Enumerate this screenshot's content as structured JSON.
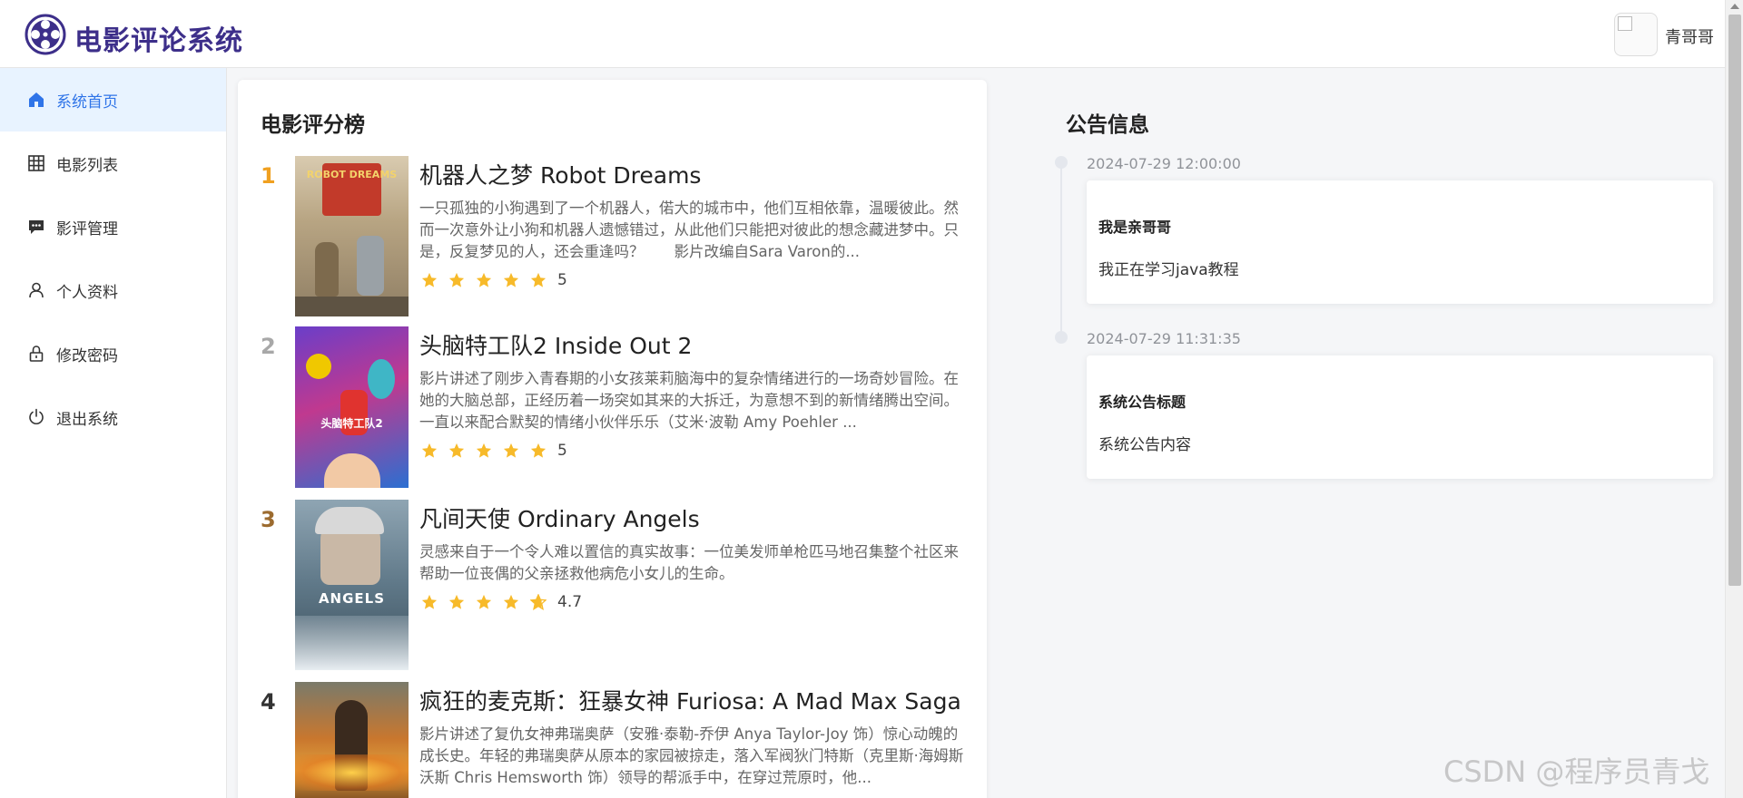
{
  "header": {
    "app_title": "电影评论系统",
    "user_name": "青哥哥",
    "brand_color": "#3d2f8a"
  },
  "sidebar": {
    "items": [
      {
        "label": "系统首页",
        "icon": "home-icon",
        "active": true
      },
      {
        "label": "电影列表",
        "icon": "grid-icon",
        "active": false
      },
      {
        "label": "影评管理",
        "icon": "comment-icon",
        "active": false
      },
      {
        "label": "个人资料",
        "icon": "user-icon",
        "active": false
      },
      {
        "label": "修改密码",
        "icon": "lock-icon",
        "active": false
      },
      {
        "label": "退出系统",
        "icon": "power-icon",
        "active": false
      }
    ]
  },
  "ranking": {
    "title": "电影评分榜",
    "movies": [
      {
        "rank": "1",
        "rank_color": "#f0a020",
        "title": "机器人之梦 Robot Dreams",
        "description": "一只孤独的小狗遇到了一个机器人，偌大的城市中，他们互相依靠，温暖彼此。然而一次意外让小狗和机器人遗憾错过，从此他们只能把对彼此的想念藏进梦中。只是，反复梦见的人，还会重逢吗？　　影片改编自Sara Varon的...",
        "score": "5",
        "stars": 5,
        "poster_text": "ROBOT DREAMS"
      },
      {
        "rank": "2",
        "rank_color": "#a8a8a8",
        "title": "头脑特工队2 Inside Out 2",
        "description": "影片讲述了刚步入青春期的小女孩莱莉脑海中的复杂情绪进行的一场奇妙冒险。在她的大脑总部，正经历着一场突如其来的大拆迁，为意想不到的新情绪腾出空间。一直以来配合默契的情绪小伙伴乐乐（艾米·波勒 Amy Poehler ...",
        "score": "5",
        "stars": 5,
        "poster_text": "头脑特工队2"
      },
      {
        "rank": "3",
        "rank_color": "#9c6b2f",
        "title": "凡间天使 Ordinary Angels",
        "description": "灵感来自于一个令人难以置信的真实故事：一位美发师单枪匹马地召集整个社区来帮助一位丧偶的父亲拯救他病危小女儿的生命。",
        "score": "4.7",
        "stars": 4.7,
        "poster_text": "ANGELS"
      },
      {
        "rank": "4",
        "rank_color": "#333333",
        "title": "疯狂的麦克斯：狂暴女神 Furiosa: A Mad Max Saga",
        "description": "影片讲述了复仇女神弗瑞奥萨（安雅·泰勒-乔伊 Anya Taylor-Joy 饰）惊心动魄的成长史。年轻的弗瑞奥萨从原本的家园被掠走，落入军阀狄门特斯（克里斯·海姆斯沃斯 Chris Hemsworth 饰）领导的帮派手中，在穿过荒原时，他...",
        "score": "",
        "stars": 0,
        "poster_text": ""
      }
    ]
  },
  "notices": {
    "title": "公告信息",
    "items": [
      {
        "time": "2024-07-29 12:00:00",
        "heading": "我是亲哥哥",
        "body": "我正在学习java教程"
      },
      {
        "time": "2024-07-29 11:31:35",
        "heading": "系统公告标题",
        "body": "系统公告内容"
      }
    ]
  },
  "watermark": "CSDN @程序员青戈",
  "star_color": "#f7ba2a",
  "active_color": "#2f74e8"
}
